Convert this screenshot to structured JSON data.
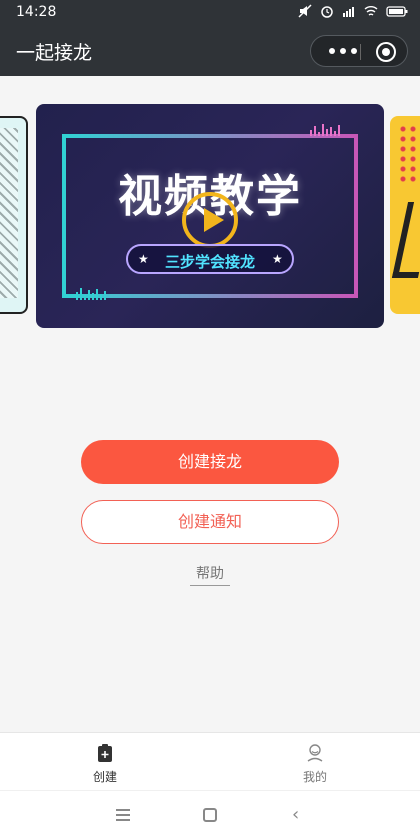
{
  "status": {
    "time": "14:28"
  },
  "nav": {
    "title": "一起接龙"
  },
  "banner": {
    "title": "视频教学",
    "subtitle": "三步学会接龙"
  },
  "actions": {
    "create_relay": "创建接龙",
    "create_notice": "创建通知",
    "help": "帮助"
  },
  "tabs": [
    {
      "label": "创建",
      "icon": "create-doc-icon",
      "active": true
    },
    {
      "label": "我的",
      "icon": "user-icon",
      "active": false
    }
  ],
  "colors": {
    "primary": "#fb5740",
    "outline": "#f26155",
    "navbar": "#2f3337"
  }
}
